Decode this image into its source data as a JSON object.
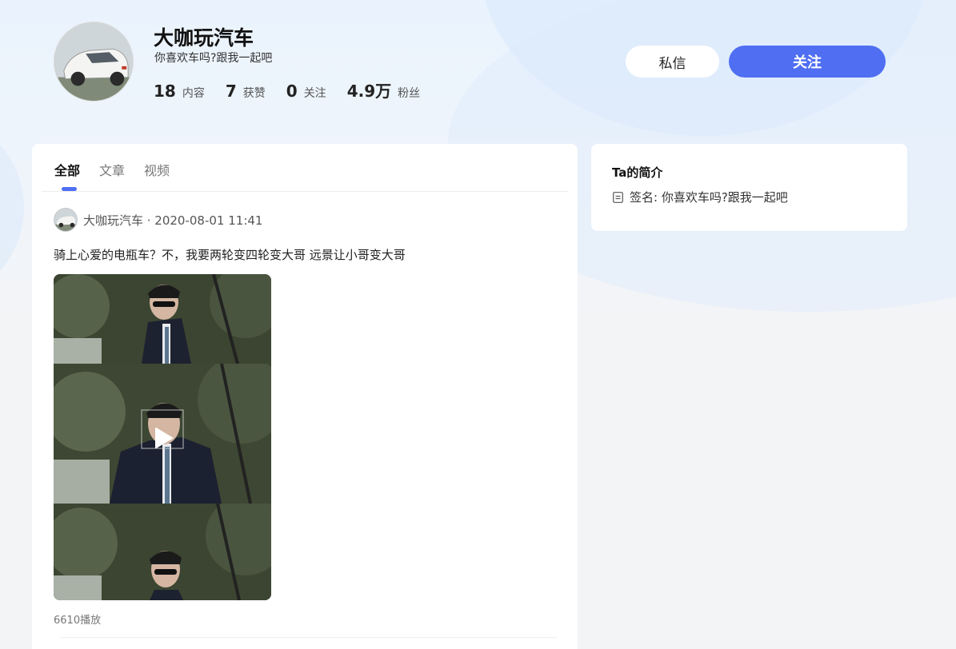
{
  "profile": {
    "name": "大咖玩汽车",
    "bio": "你喜欢车吗?跟我一起吧",
    "stats": [
      {
        "num": "18",
        "label": "内容"
      },
      {
        "num": "7",
        "label": "获赞"
      },
      {
        "num": "0",
        "label": "关注"
      },
      {
        "num": "4.9万",
        "label": "粉丝"
      }
    ]
  },
  "actions": {
    "message_label": "私信",
    "follow_label": "关注"
  },
  "tabs": [
    {
      "label": "全部",
      "active": true
    },
    {
      "label": "文章",
      "active": false
    },
    {
      "label": "视频",
      "active": false
    }
  ],
  "post": {
    "author": "大咖玩汽车",
    "meta": "大咖玩汽车 · 2020-08-01 11:41",
    "title": "骑上心爱的电瓶车？不，我要两轮变四轮变大哥 远景让小哥变大哥",
    "plays": "6610播放"
  },
  "sidebar": {
    "title": "Ta的简介",
    "signature": "签名: 你喜欢车吗?跟我一起吧"
  },
  "colors": {
    "accent": "#4f6ef2",
    "card": "#ffffff",
    "background": "#f3f4f6"
  }
}
